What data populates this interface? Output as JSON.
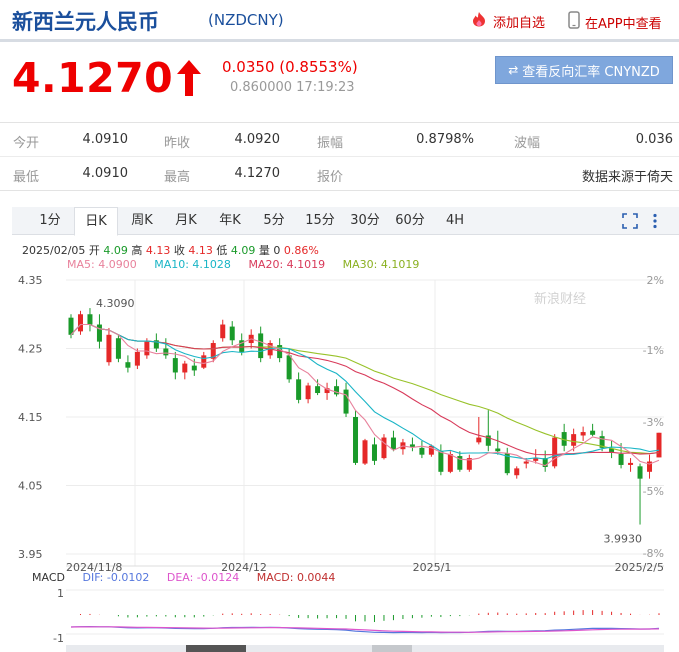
{
  "header": {
    "title": "新西兰元人民币",
    "code": "(NZDCNY)",
    "add_fav": "添加自选",
    "app_view": "在APP中查看"
  },
  "quote": {
    "price": "4.1270",
    "change": "0.0350 (0.8553%)",
    "sub": "0.860000 17:19:23",
    "reverse_btn": "查看反向汇率 CNYNZD"
  },
  "stats": [
    [
      {
        "label": "今开",
        "value": "4.0910"
      },
      {
        "label": "昨收",
        "value": "4.0920"
      },
      {
        "label": "振幅",
        "value": "0.8798%"
      },
      {
        "label": "波幅",
        "value": "0.036"
      }
    ],
    [
      {
        "label": "最低",
        "value": "4.0910"
      },
      {
        "label": "最高",
        "value": "4.1270"
      },
      {
        "label": "报价",
        "value": ""
      },
      {
        "label": "",
        "value": "数据来源于倚天"
      }
    ]
  ],
  "tabs": [
    "1分",
    "日K",
    "周K",
    "月K",
    "年K",
    "5分",
    "15分",
    "30分",
    "60分",
    "4H"
  ],
  "active_tab": 1,
  "info": {
    "date": "2025/02/05",
    "open_label": "开",
    "open": "4.09",
    "high_label": "高",
    "high": "4.13",
    "close_label": "收",
    "close": "4.13",
    "low_label": "低",
    "low": "4.09",
    "vol_label": "量",
    "vol": "0",
    "pct": "0.86%"
  },
  "ma": {
    "ma5": "MA5: 4.0900",
    "ma10": "MA10: 4.1028",
    "ma20": "MA20: 4.1019",
    "ma30": "MA30: 4.1019"
  },
  "macd": {
    "label": "MACD",
    "dif": "DIF: -0.0102",
    "dea": "DEA: -0.0124",
    "macd": "MACD: 0.0044"
  },
  "watermark": "新浪财经",
  "colors": {
    "up": "#e52828",
    "down": "#1a9a2a",
    "brand": "#1a4f9c",
    "ma5": "#e8829c",
    "ma10": "#1ab5c6",
    "ma20": "#d83a5a",
    "ma30": "#98c22a",
    "dif": "#5577dd",
    "dea": "#dd55cc"
  },
  "chart_data": {
    "type": "candlestick",
    "y_ticks": [
      "4.35",
      "4.25",
      "4.15",
      "4.05",
      "3.95"
    ],
    "ylim": [
      3.95,
      4.35
    ],
    "pct_ticks": [
      "2%",
      "-1%",
      "-3%",
      "-5%",
      "-8%"
    ],
    "x_labels": [
      "2024/11/8",
      "2024/12",
      "2025/1",
      "2025/2/5"
    ],
    "annotations": {
      "max": "4.3090",
      "min": "3.9930"
    },
    "candles": [
      [
        4.295,
        4.3,
        4.265,
        4.27
      ],
      [
        4.275,
        4.305,
        4.27,
        4.3
      ],
      [
        4.3,
        4.309,
        4.275,
        4.285
      ],
      [
        4.285,
        4.3,
        4.25,
        4.26
      ],
      [
        4.23,
        4.28,
        4.225,
        4.27
      ],
      [
        4.265,
        4.27,
        4.23,
        4.235
      ],
      [
        4.23,
        4.24,
        4.215,
        4.222
      ],
      [
        4.225,
        4.25,
        4.22,
        4.245
      ],
      [
        4.24,
        4.265,
        4.235,
        4.26
      ],
      [
        4.262,
        4.272,
        4.245,
        4.25
      ],
      [
        4.25,
        4.265,
        4.235,
        4.24
      ],
      [
        4.236,
        4.245,
        4.205,
        4.215
      ],
      [
        4.215,
        4.232,
        4.205,
        4.228
      ],
      [
        4.225,
        4.235,
        4.21,
        4.218
      ],
      [
        4.222,
        4.245,
        4.22,
        4.24
      ],
      [
        4.235,
        4.262,
        4.23,
        4.258
      ],
      [
        4.265,
        4.292,
        4.26,
        4.285
      ],
      [
        4.282,
        4.29,
        4.255,
        4.262
      ],
      [
        4.262,
        4.272,
        4.24,
        4.245
      ],
      [
        4.258,
        4.278,
        4.25,
        4.27
      ],
      [
        4.272,
        4.282,
        4.23,
        4.236
      ],
      [
        4.24,
        4.262,
        4.235,
        4.258
      ],
      [
        4.255,
        4.265,
        4.23,
        4.236
      ],
      [
        4.24,
        4.25,
        4.2,
        4.205
      ],
      [
        4.205,
        4.215,
        4.17,
        4.175
      ],
      [
        4.176,
        4.2,
        4.17,
        4.196
      ],
      [
        4.195,
        4.205,
        4.182,
        4.185
      ],
      [
        4.185,
        4.2,
        4.175,
        4.192
      ],
      [
        4.195,
        4.205,
        4.18,
        4.183
      ],
      [
        4.19,
        4.2,
        4.15,
        4.155
      ],
      [
        4.15,
        4.16,
        4.08,
        4.083
      ],
      [
        4.082,
        4.118,
        4.08,
        4.116
      ],
      [
        4.11,
        4.12,
        4.08,
        4.086
      ],
      [
        4.09,
        4.125,
        4.088,
        4.12
      ],
      [
        4.12,
        4.13,
        4.1,
        4.103
      ],
      [
        4.103,
        4.118,
        4.095,
        4.113
      ],
      [
        4.11,
        4.12,
        4.1,
        4.106
      ],
      [
        4.105,
        4.115,
        4.09,
        4.095
      ],
      [
        4.095,
        4.11,
        4.092,
        4.108
      ],
      [
        4.1,
        4.11,
        4.065,
        4.07
      ],
      [
        4.07,
        4.1,
        4.068,
        4.096
      ],
      [
        4.093,
        4.1,
        4.07,
        4.073
      ],
      [
        4.073,
        4.095,
        4.07,
        4.09
      ],
      [
        4.113,
        4.15,
        4.11,
        4.12
      ],
      [
        4.123,
        4.16,
        4.1,
        4.108
      ],
      [
        4.104,
        4.13,
        4.095,
        4.1
      ],
      [
        4.097,
        4.105,
        4.065,
        4.068
      ],
      [
        4.065,
        4.078,
        4.06,
        4.075
      ],
      [
        4.082,
        4.09,
        4.075,
        4.085
      ],
      [
        4.086,
        4.103,
        4.082,
        4.09
      ],
      [
        4.09,
        4.101,
        4.07,
        4.077
      ],
      [
        4.078,
        4.125,
        4.075,
        4.12
      ],
      [
        4.128,
        4.14,
        4.1,
        4.108
      ],
      [
        4.108,
        4.133,
        4.1,
        4.125
      ],
      [
        4.123,
        4.136,
        4.115,
        4.128
      ],
      [
        4.13,
        4.14,
        4.122,
        4.124
      ],
      [
        4.122,
        4.13,
        4.1,
        4.105
      ],
      [
        4.104,
        4.115,
        4.09,
        4.098
      ],
      [
        4.096,
        4.112,
        4.075,
        4.08
      ],
      [
        4.08,
        4.09,
        4.07,
        4.083
      ],
      [
        4.078,
        4.082,
        3.993,
        4.06
      ],
      [
        4.07,
        4.095,
        4.06,
        4.085
      ],
      [
        4.091,
        4.127,
        4.091,
        4.127
      ]
    ]
  }
}
